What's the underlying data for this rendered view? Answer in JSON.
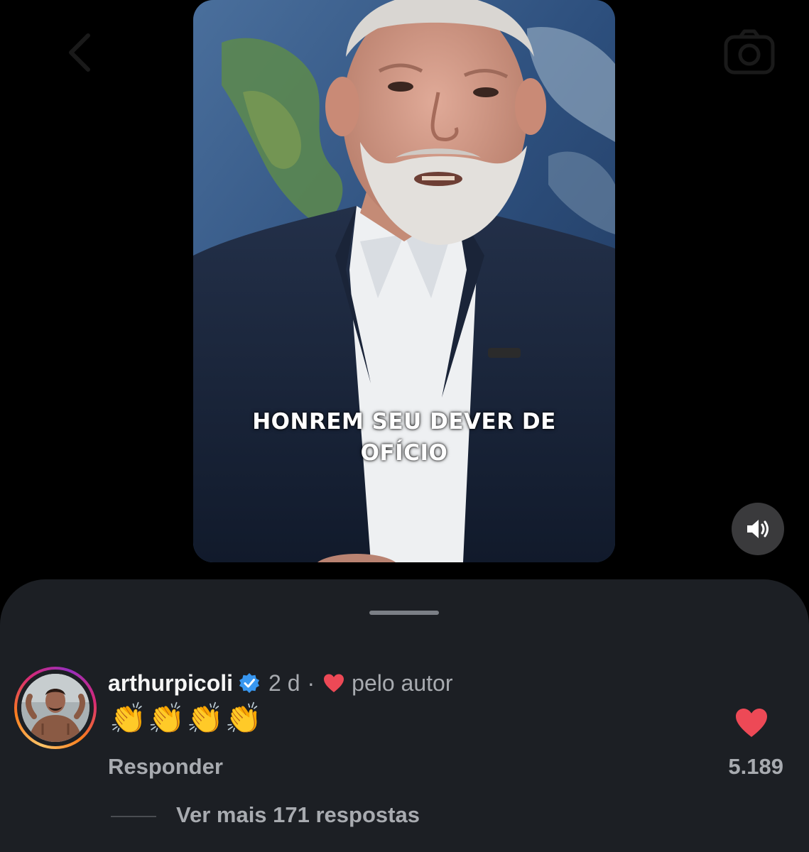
{
  "video": {
    "caption_line1": "HONREM SEU DEVER DE",
    "caption_line2": "OFÍCIO"
  },
  "icons": {
    "back": "chevron-left-icon",
    "camera": "camera-icon",
    "sound": "speaker-on-icon",
    "verified": "verified-badge-icon",
    "heart": "heart-icon"
  },
  "comment": {
    "username": "arthurpicoli",
    "time": "2 d",
    "separator": "·",
    "liked_by_label": "pelo autor",
    "text": "👏👏👏👏",
    "reply_label": "Responder",
    "like_count": "5.189",
    "view_replies_label": "Ver mais 171 respostas"
  },
  "colors": {
    "background": "#000000",
    "sheet": "#1c1f24",
    "secondary_text": "#a8abb0",
    "like_red": "#ed4956",
    "verified_blue": "#3897f0"
  }
}
